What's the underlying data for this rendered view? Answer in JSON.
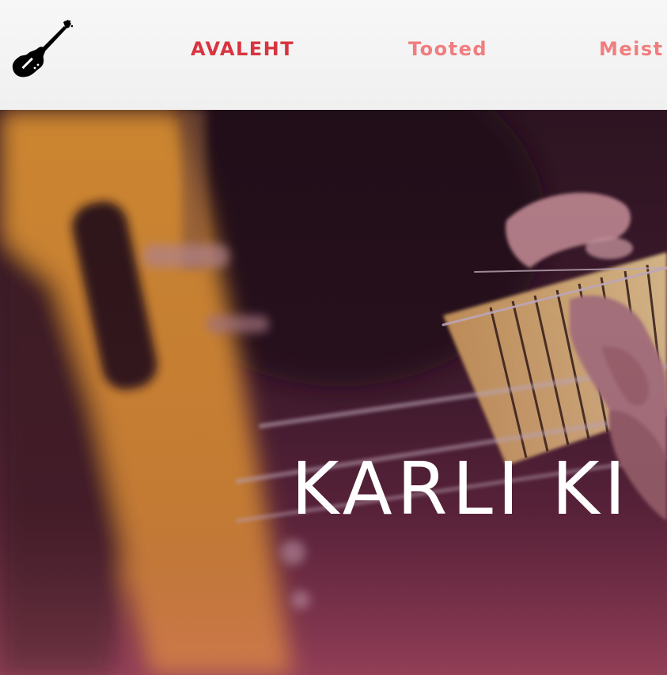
{
  "header": {
    "logo_icon": "guitar-icon",
    "nav": {
      "home": "AVALEHT",
      "products": "Tooted",
      "about": "Meist"
    }
  },
  "colors": {
    "nav_active": "#d8343f",
    "nav_inactive": "#f17d7f",
    "header_bg": "#f3f3f3",
    "hero_overlay": "#5a1a3a"
  },
  "hero": {
    "title": "KARLI KI"
  }
}
